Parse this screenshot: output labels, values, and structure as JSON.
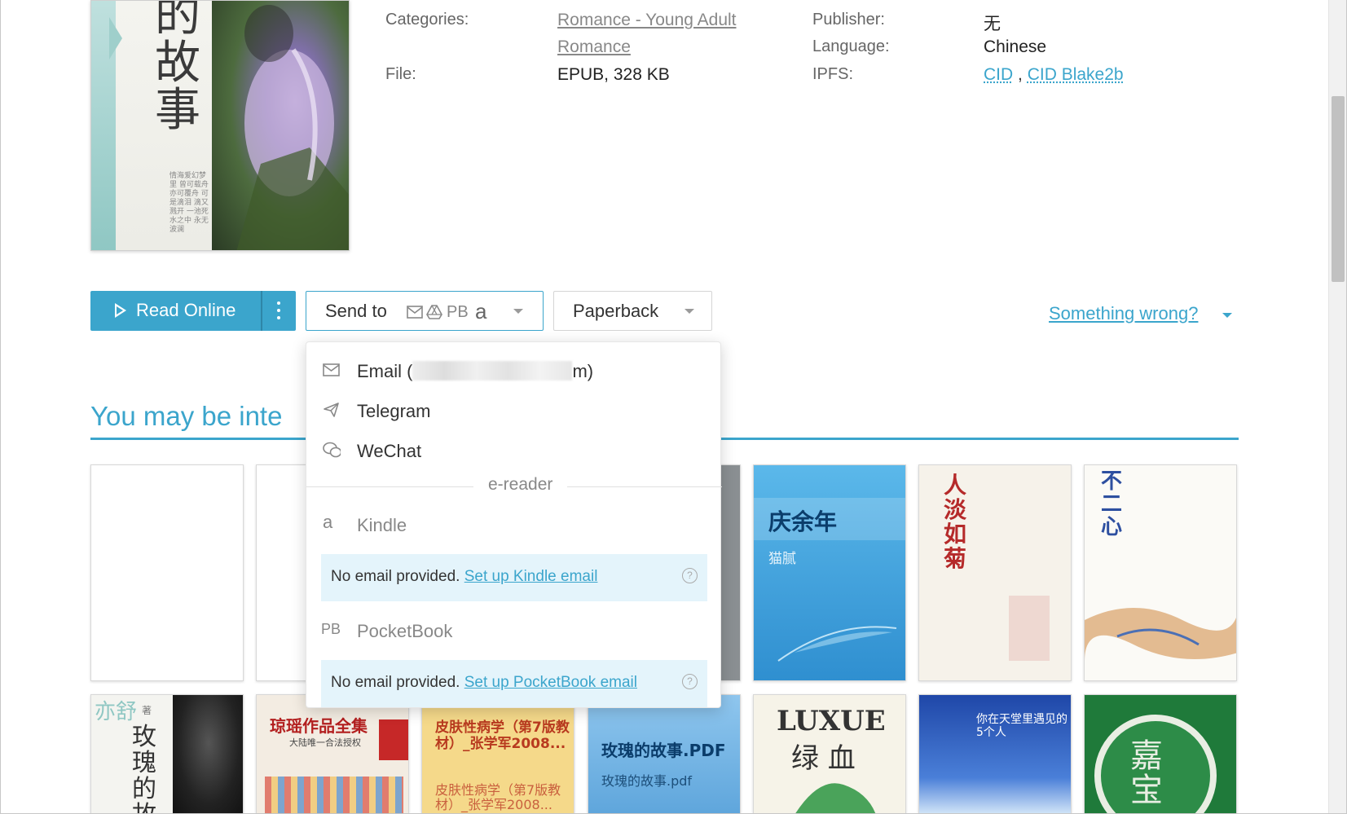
{
  "meta": {
    "categories_label": "Categories:",
    "categories_value_1": "Romance - Young Adult",
    "categories_value_2": "Romance",
    "file_label": "File:",
    "file_value": "EPUB, 328 KB",
    "publisher_label": "Publisher:",
    "publisher_value": "无",
    "language_label": "Language:",
    "language_value": "Chinese",
    "ipfs_label": "IPFS:",
    "ipfs_cid": "CID",
    "ipfs_sep": ",",
    "ipfs_cid_blake": "CID Blake2b"
  },
  "cover": {
    "title_chars": "的故事",
    "small_text": "情海爱幻梦里 曾可载舟 亦可覆舟 可是滴泪 滴又溅开 一池死水之中 永无波澜"
  },
  "actions": {
    "read_online": "Read Online",
    "send_to": "Send to",
    "send_to_pb": "PB",
    "send_to_amazon": "a",
    "paperback": "Paperback",
    "something_wrong": "Something wrong?"
  },
  "section": {
    "title": "You may be inte"
  },
  "dropdown": {
    "email_prefix": "Email (",
    "email_suffix": "m)",
    "telegram": "Telegram",
    "wechat": "WeChat",
    "ereader_label": "e-reader",
    "kindle": "Kindle",
    "kindle_note": "No email provided.",
    "kindle_link": "Set up Kindle email",
    "pocketbook_badge": "PB",
    "pocketbook": "PocketBook",
    "pocketbook_note": "No email provided.",
    "pocketbook_link": "Set up PocketBook email",
    "help_glyph": "?"
  },
  "books": {
    "b1_title": "庆余年",
    "b1_author": "猫腻",
    "b2_title": "人淡如菊",
    "b3_title": "不二心",
    "b4_author": "亦舒",
    "b4_author_suffix": "著",
    "b4_title": "玫瑰的故",
    "b5_title": "琼瑶作品全集",
    "b5_sub": "大陆唯一合法授权",
    "b6_title": "皮肤性病学（第7版教材）_张学军2008...",
    "b6_sub": "皮肤性病学（第7版教材）_张学军2008...",
    "b7_title": "玫瑰的故事.PDF",
    "b7_sub": "玫瑰的故事.pdf",
    "b8_title": "LUXUE",
    "b8_sub": "绿 血",
    "b9_title": "你在天堂里遇见的5个人",
    "b10_title": "嘉宝"
  },
  "colors": {
    "accent": "#3ba5cc",
    "note_bg": "#e4f4fb"
  }
}
